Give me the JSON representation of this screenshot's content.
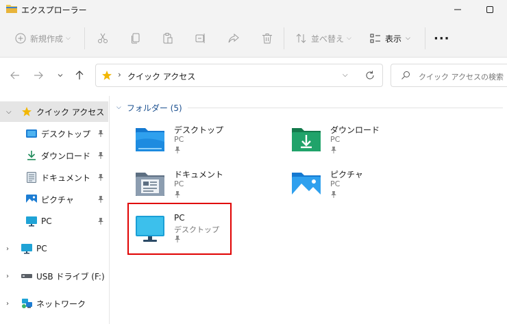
{
  "window": {
    "title": "エクスプローラー"
  },
  "toolbar": {
    "new_label": "新規作成",
    "sort_label": "並べ替え",
    "view_label": "表示",
    "more_label": "···"
  },
  "address": {
    "location": "クイック アクセス",
    "search_placeholder": "クイック アクセスの検索"
  },
  "sidebar": {
    "items": [
      {
        "label": "クイック アクセス",
        "icon": "star-icon",
        "selected": true,
        "expanded": true
      },
      {
        "label": "デスクトップ",
        "icon": "desktop-icon",
        "pinned": true
      },
      {
        "label": "ダウンロード",
        "icon": "download-icon",
        "pinned": true
      },
      {
        "label": "ドキュメント",
        "icon": "document-icon",
        "pinned": true
      },
      {
        "label": "ピクチャ",
        "icon": "picture-icon",
        "pinned": true
      },
      {
        "label": "PC",
        "icon": "monitor-icon",
        "pinned": true
      },
      {
        "label": "PC",
        "icon": "monitor-icon",
        "expandable": true
      },
      {
        "label": "USB ドライブ (F:)",
        "icon": "usb-drive-icon",
        "expandable": true
      },
      {
        "label": "ネットワーク",
        "icon": "network-icon",
        "expandable": true
      }
    ]
  },
  "main": {
    "group_title": "フォルダー (5)",
    "tiles": [
      {
        "name": "デスクトップ",
        "location": "PC",
        "icon": "desktop-folder-icon"
      },
      {
        "name": "ダウンロード",
        "location": "PC",
        "icon": "download-folder-icon"
      },
      {
        "name": "ドキュメント",
        "location": "PC",
        "icon": "document-folder-icon"
      },
      {
        "name": "ピクチャ",
        "location": "PC",
        "icon": "picture-folder-icon"
      },
      {
        "name": "PC",
        "location": "デスクトップ",
        "icon": "pc-monitor-icon",
        "highlighted": true
      }
    ]
  },
  "colors": {
    "accent": "#1a4f8f",
    "highlight": "#e00000",
    "folder": "#2d8ad8",
    "star": "#f2b705"
  }
}
